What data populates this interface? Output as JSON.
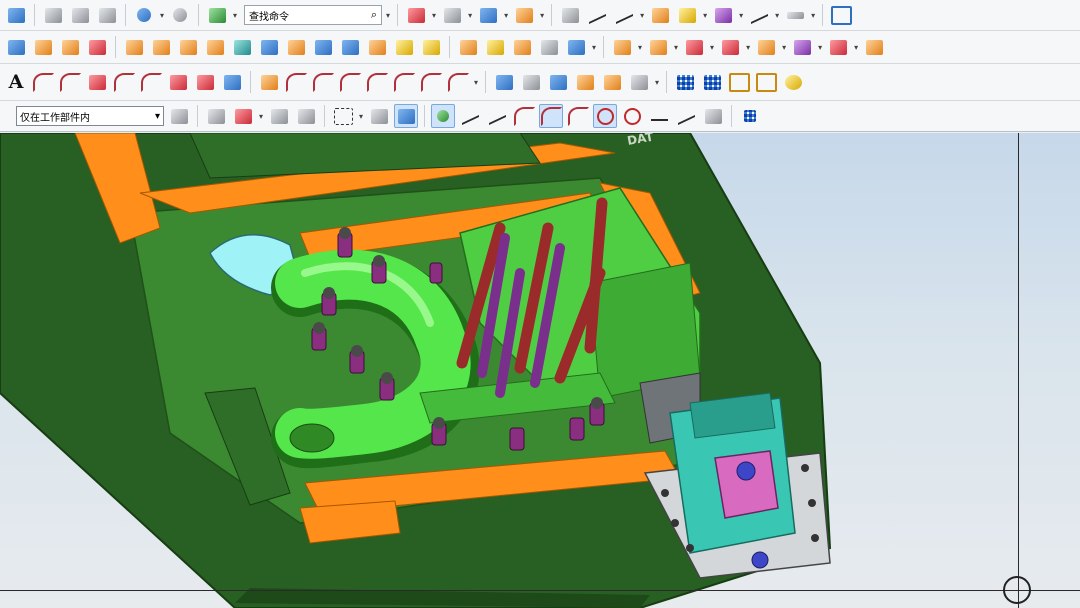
{
  "toolbar": {
    "command_search": {
      "value": "查找命令"
    },
    "selection_filter": {
      "value": "仅在工作部件内"
    }
  },
  "model": {
    "label": "DAT"
  },
  "colors": {
    "background_top": "#c6d8ea",
    "base_green": "#2d6b28",
    "orange_rail": "#ff8f1a",
    "tube_green": "#55e64b",
    "maroon_pins": "#9b2a2a",
    "purple_pins": "#7a2f8c",
    "clamp_cyan": "#39c7b4",
    "clamp_pink": "#d86ac0"
  }
}
